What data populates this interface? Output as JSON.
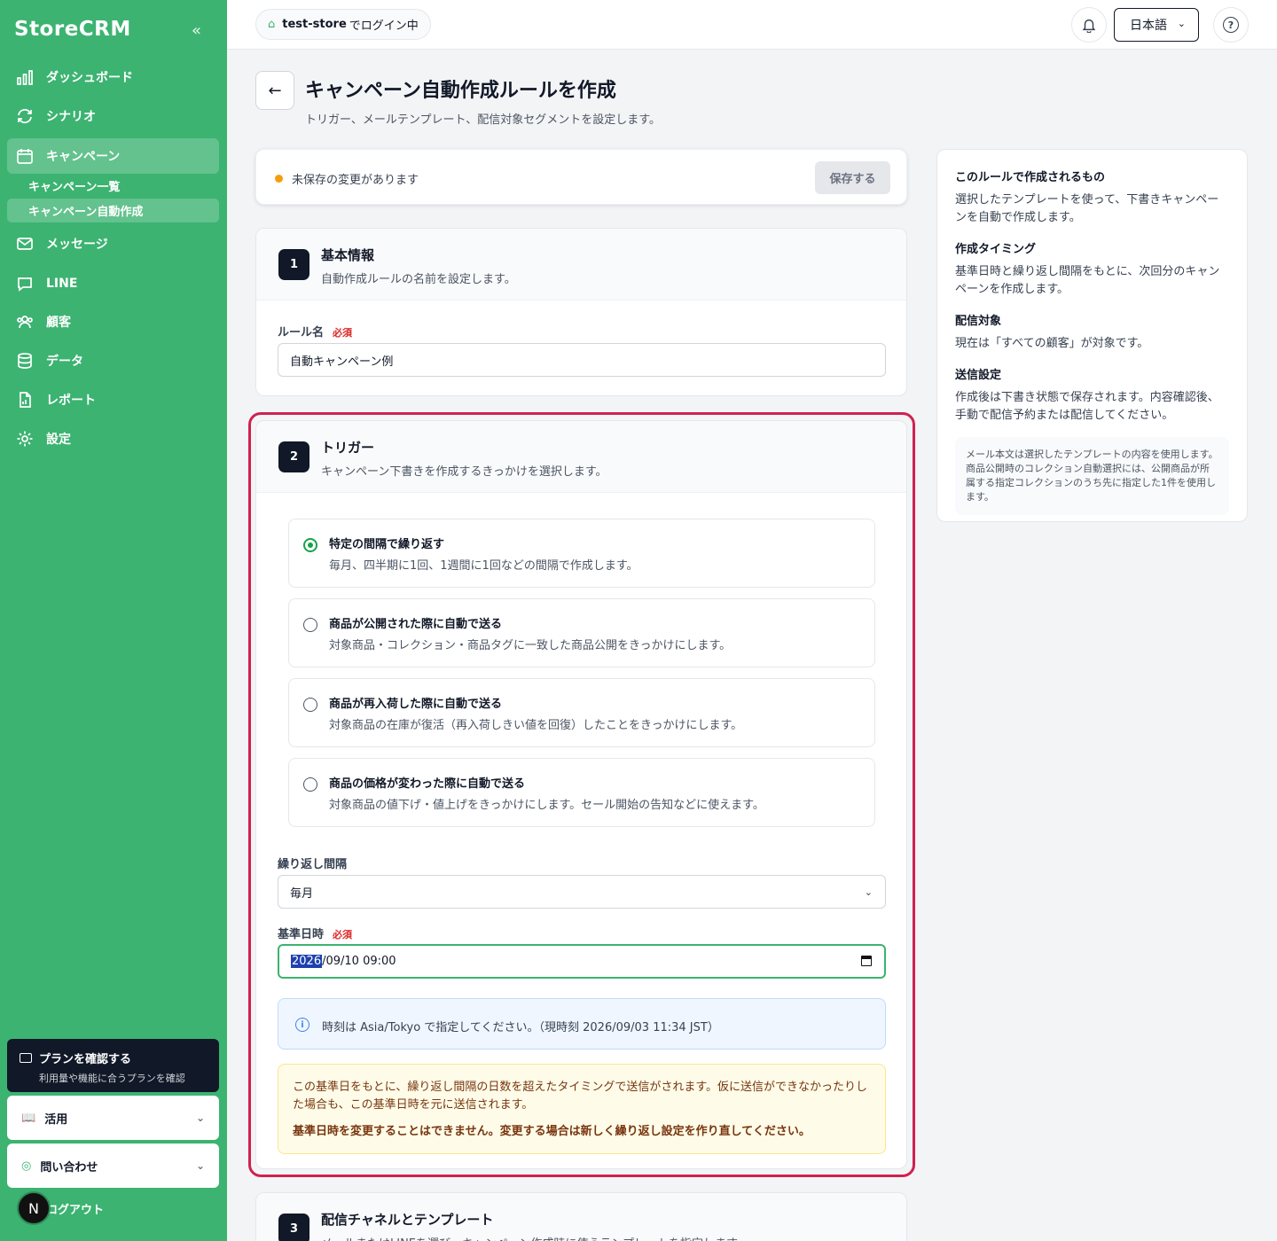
{
  "sidebar": {
    "brand": "StoreCRM",
    "nav": [
      {
        "label": "ダッシュボード",
        "icon": "bar-chart-icon"
      },
      {
        "label": "シナリオ",
        "icon": "refresh-icon"
      },
      {
        "label": "キャンペーン",
        "icon": "calendar-icon",
        "active": true
      },
      {
        "label": "メッセージ",
        "icon": "mail-icon"
      },
      {
        "label": "LINE",
        "icon": "chat-icon"
      },
      {
        "label": "顧客",
        "icon": "users-icon"
      },
      {
        "label": "データ",
        "icon": "database-icon"
      },
      {
        "label": "レポート",
        "icon": "file-icon"
      },
      {
        "label": "設定",
        "icon": "gear-icon"
      }
    ],
    "sub_items": [
      "キャンペーン一覧",
      "キャンペーン自動作成"
    ],
    "plan_title": "プランを確認する",
    "plan_sub": "利用量や機能に合うプランを確認",
    "accordion": [
      "活用",
      "問い合わせ"
    ],
    "avatar": "N",
    "logout": "ログアウト"
  },
  "header": {
    "store": "test-store",
    "store_suffix": "でログイン中",
    "language": "日本語"
  },
  "page": {
    "title": "キャンペーン自動作成ルールを作成",
    "subtitle": "トリガー、メールテンプレート、配信対象セグメントを設定します。"
  },
  "savebar": {
    "message": "未保存の変更があります",
    "save_label": "保存する"
  },
  "section1": {
    "step": "1",
    "title": "基本情報",
    "subtitle": "自動作成ルールの名前を設定します。",
    "name_label": "ルール名",
    "required": "必須",
    "name_value": "自動キャンペーン例"
  },
  "section2": {
    "step": "2",
    "title": "トリガー",
    "subtitle": "キャンペーン下書きを作成するきっかけを選択します。",
    "options": [
      {
        "title": "特定の間隔で繰り返す",
        "desc": "毎月、四半期に1回、1週間に1回などの間隔で作成します。",
        "checked": true
      },
      {
        "title": "商品が公開された際に自動で送る",
        "desc": "対象商品・コレクション・商品タグに一致した商品公開をきっかけにします。",
        "checked": false
      },
      {
        "title": "商品が再入荷した際に自動で送る",
        "desc": "対象商品の在庫が復活（再入荷しきい値を回復）したことをきっかけにします。",
        "checked": false
      },
      {
        "title": "商品の価格が変わった際に自動で送る",
        "desc": "対象商品の値下げ・値上げをきっかけにします。セール開始の告知などに使えます。",
        "checked": false
      }
    ],
    "interval_label": "繰り返し間隔",
    "interval_value": "毎月",
    "base_label": "基準日時",
    "required": "必須",
    "date_year": "2026",
    "date_rest": "/09/10 09:00",
    "info": "時刻は Asia/Tokyo で指定してください。（現時刻 2026/09/03 11:34 JST）",
    "warn": "この基準日をもとに、繰り返し間隔の日数を超えたタイミングで送信がされます。仮に送信ができなかったりした場合も、この基準日時を元に送信されます。",
    "warn_strong": "基準日時を変更することはできません。変更する場合は新しく繰り返し設定を作り直してください。"
  },
  "section3": {
    "step": "3",
    "title": "配信チャネルとテンプレート",
    "subtitle": "メールまたはLINEを選び、キャンペーン作成時に使うテンプレートを指定します。"
  },
  "panel": {
    "h1": "このルールで作成されるもの",
    "p1": "選択したテンプレートを使って、下書きキャンペーンを自動で作成します。",
    "h2": "作成タイミング",
    "p2": "基準日時と繰り返し間隔をもとに、次回分のキャンペーンを作成します。",
    "h3": "配信対象",
    "p3": "現在は「すべての顧客」が対象です。",
    "h4": "送信設定",
    "p4": "作成後は下書き状態で保存されます。内容確認後、手動で配信予約または配信してください。",
    "note": "メール本文は選択したテンプレートの内容を使用します。商品公開時のコレクション自動選択には、公開商品が所属する指定コレクションのうち先に指定した1件を使用します。"
  },
  "colors": {
    "sidebar": "#3cb371",
    "accent": "#16a34a",
    "highlight": "#d0214f",
    "dark": "#111827"
  }
}
